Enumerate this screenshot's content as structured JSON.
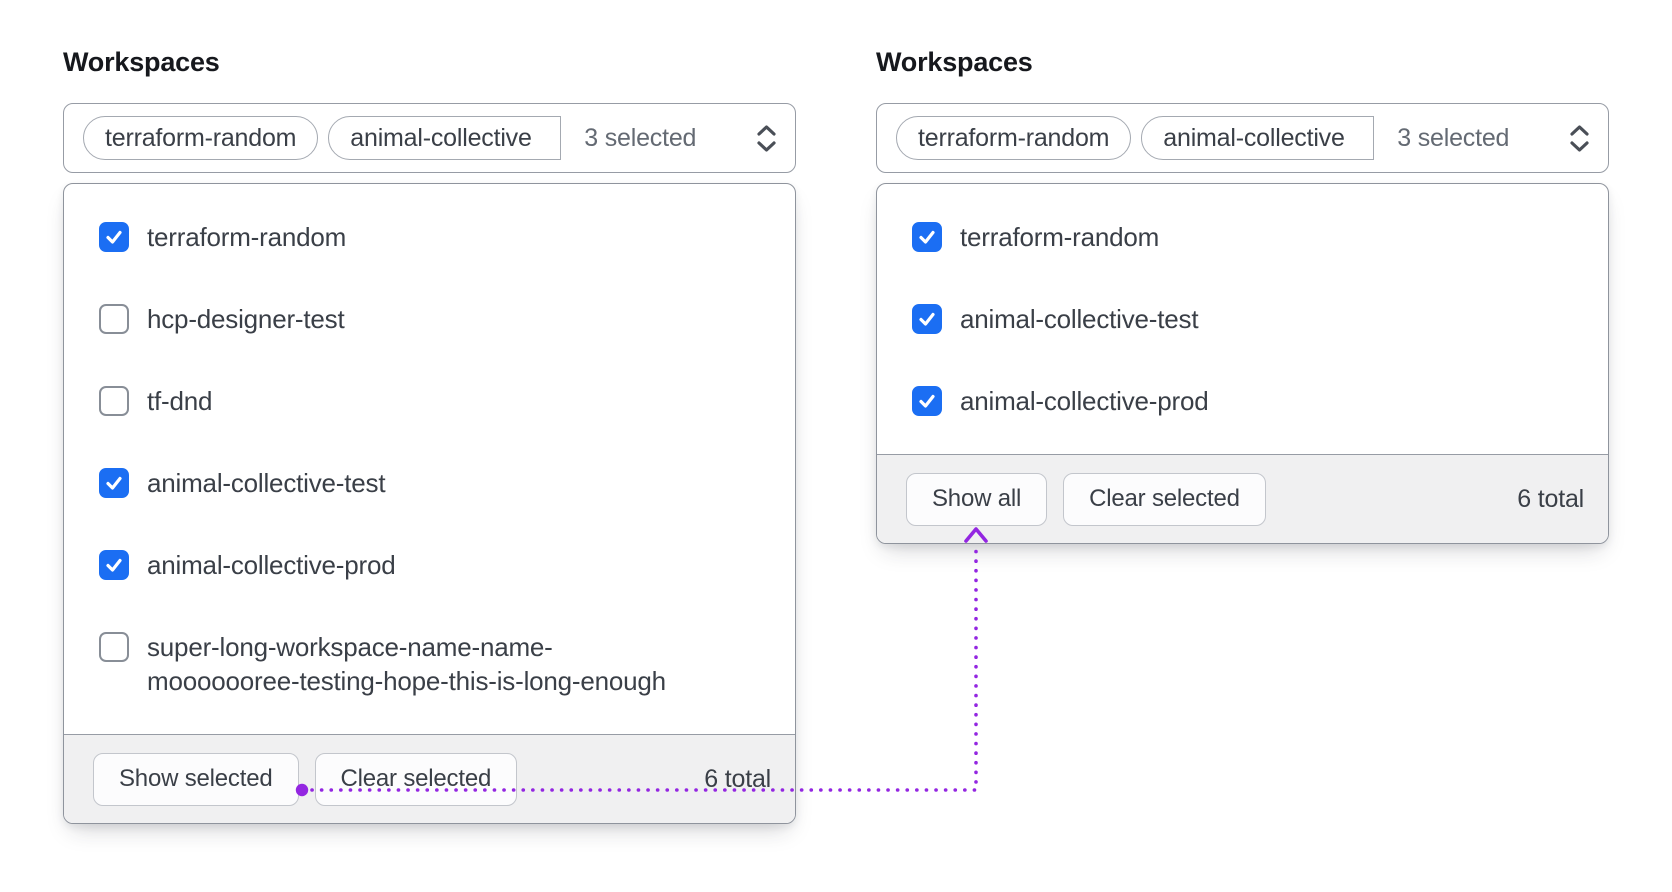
{
  "colors": {
    "checkbox_blue": "#1b6ef3",
    "annotation_purple": "#9326e1",
    "border_gray": "#979ca5",
    "footer_gray": "#f0f0f1",
    "text_primary": "#3a3f47",
    "text_muted": "#646a73"
  },
  "panels": [
    {
      "label": "Workspaces",
      "select": {
        "tags": [
          "terraform-random",
          "animal-collective"
        ],
        "count": "3 selected"
      },
      "options": [
        {
          "label": "terraform-random",
          "checked": true
        },
        {
          "label": "hcp-designer-test",
          "checked": false
        },
        {
          "label": "tf-dnd",
          "checked": false
        },
        {
          "label": "animal-collective-test",
          "checked": true
        },
        {
          "label": "animal-collective-prod",
          "checked": true
        },
        {
          "label": "super-long-workspace-name-name-mooooooree-testing-hope-this-is-long-enough",
          "label_lines": [
            "super-long-workspace-name-name-",
            "mooooooree-testing-hope-this-is-long-enough"
          ],
          "checked": false
        }
      ],
      "footer": {
        "show_button": "Show selected",
        "clear_button": "Clear selected",
        "total": "6 total"
      }
    },
    {
      "label": "Workspaces",
      "select": {
        "tags": [
          "terraform-random",
          "animal-collective"
        ],
        "count": "3 selected"
      },
      "options": [
        {
          "label": "terraform-random",
          "checked": true
        },
        {
          "label": "animal-collective-test",
          "checked": true
        },
        {
          "label": "animal-collective-prod",
          "checked": true
        }
      ],
      "footer": {
        "show_button": "Show all",
        "clear_button": "Clear selected",
        "total": "6 total"
      }
    }
  ],
  "annotation_arrow": {
    "from": "show-selected-button",
    "to": "show-all-button"
  }
}
